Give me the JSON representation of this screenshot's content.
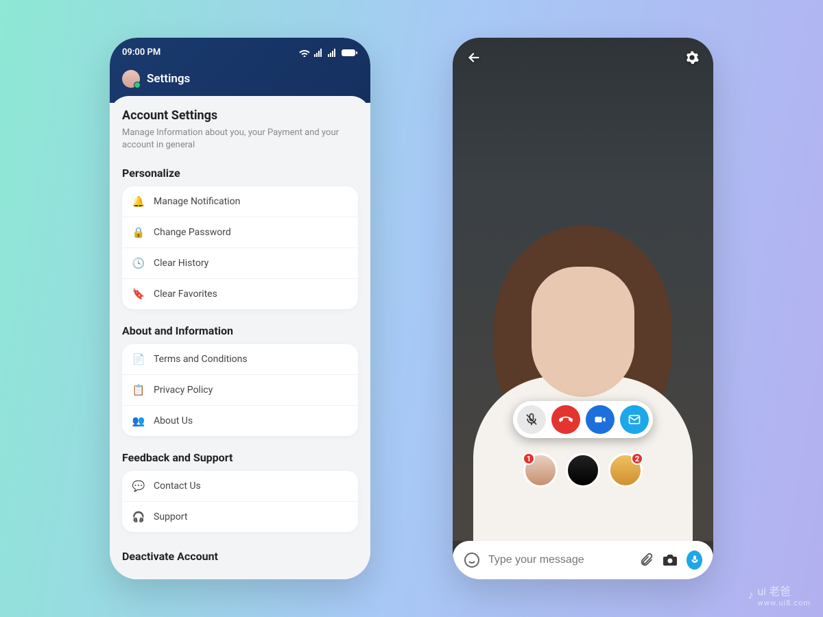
{
  "settings": {
    "status_time": "09:00 PM",
    "title": "Settings",
    "account_title": "Account Settings",
    "account_sub": "Manage Information about you, your Payment and your account in general",
    "groups": [
      {
        "label": "Personalize",
        "items": [
          {
            "icon": "bell-icon",
            "glyph": "🔔",
            "label": "Manage Notification"
          },
          {
            "icon": "lock-icon",
            "glyph": "🔒",
            "label": "Change Password"
          },
          {
            "icon": "clock-icon",
            "glyph": "🕓",
            "label": "Clear History"
          },
          {
            "icon": "bookmark-icon",
            "glyph": "🔖",
            "label": "Clear Favorites"
          }
        ]
      },
      {
        "label": "About and Information",
        "items": [
          {
            "icon": "document-icon",
            "glyph": "📄",
            "label": "Terms and Conditions"
          },
          {
            "icon": "shield-icon",
            "glyph": "📋",
            "label": "Privacy Policy"
          },
          {
            "icon": "people-icon",
            "glyph": "👥",
            "label": "About Us"
          }
        ]
      },
      {
        "label": "Feedback and Support",
        "items": [
          {
            "icon": "chat-icon",
            "glyph": "💬",
            "label": "Contact Us"
          },
          {
            "icon": "headset-icon",
            "glyph": "🎧",
            "label": "Support"
          }
        ]
      }
    ],
    "deactivate_label": "Deactivate Account"
  },
  "call": {
    "participants": [
      {
        "badge": "1",
        "badge_side": "l"
      },
      {
        "badge": null
      },
      {
        "badge": "2",
        "badge_side": "r"
      }
    ],
    "composer_placeholder": "Type your message"
  },
  "watermark": {
    "brand": "ui 老爸",
    "url": "www.ui8.com"
  }
}
